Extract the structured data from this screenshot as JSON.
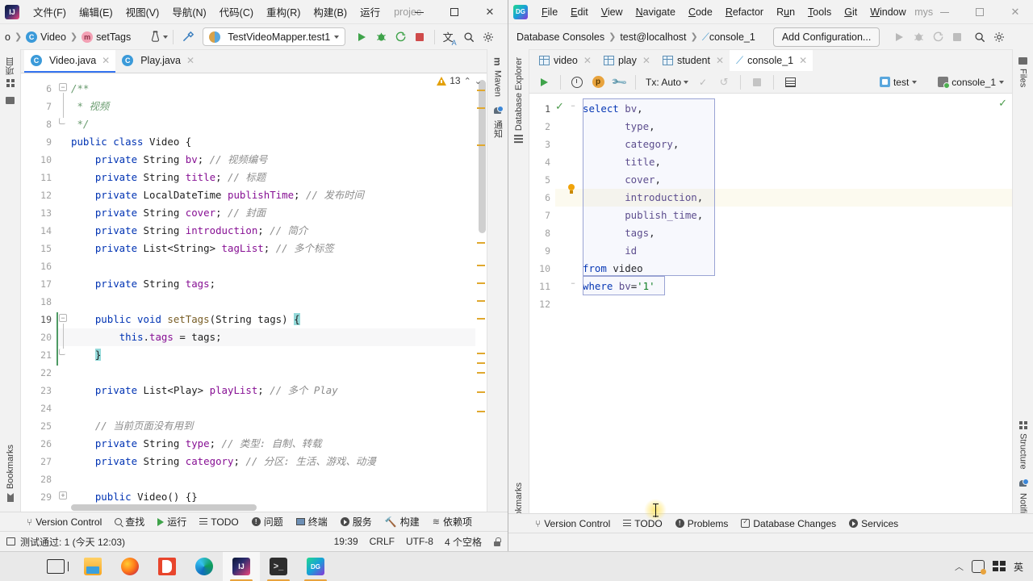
{
  "left_window": {
    "app_icon": "IJ",
    "menu": [
      {
        "label": "文件(F)",
        "key": "F"
      },
      {
        "label": "编辑(E)",
        "key": "E"
      },
      {
        "label": "视图(V)",
        "key": "V"
      },
      {
        "label": "导航(N)",
        "key": "N"
      },
      {
        "label": "代码(C)",
        "key": "C"
      },
      {
        "label": "重构(R)",
        "key": "R"
      },
      {
        "label": "构建(B)",
        "key": "B"
      },
      {
        "label": "运行",
        "key": ""
      }
    ],
    "project_name": "projec",
    "window_controls": {
      "minimize": "—",
      "maximize": "□",
      "close": "✕"
    },
    "breadcrumbs": [
      {
        "label": "o",
        "icon": ""
      },
      {
        "label": "Video",
        "icon": "class-icon"
      },
      {
        "label": "setTags",
        "icon": "method-icon"
      }
    ],
    "run_config": "TestVideoMapper.test1",
    "toolbar_icons": [
      "profiler-icon",
      "build-hammer-icon",
      "run-icon",
      "debug-icon",
      "run-coverage-icon",
      "stop-icon",
      "translate-icon",
      "search-icon",
      "settings-gear-icon"
    ],
    "editor_tabs": [
      {
        "label": "Video.java",
        "icon": "class-icon",
        "active": true
      },
      {
        "label": "Play.java",
        "icon": "class-icon",
        "active": false
      }
    ],
    "inspection_count": "13",
    "left_stripe": [
      "项目",
      "Bookmarks",
      "结构"
    ],
    "right_stripe": [
      "Maven",
      "通知"
    ],
    "bottom_tools": [
      {
        "label": "Version Control",
        "icon": "version-control-icon"
      },
      {
        "label": "查找",
        "icon": "search-icon"
      },
      {
        "label": "运行",
        "icon": "run-icon"
      },
      {
        "label": "TODO",
        "icon": "todo-icon"
      },
      {
        "label": "问题",
        "icon": "problems-icon"
      },
      {
        "label": "终端",
        "icon": "terminal-icon"
      },
      {
        "label": "服务",
        "icon": "services-icon"
      },
      {
        "label": "构建",
        "icon": "build-icon"
      },
      {
        "label": "依赖项",
        "icon": "dependencies-icon"
      }
    ],
    "status_left": "测试通过: 1 (今天 12:03)",
    "status_right": [
      "19:39",
      "CRLF",
      "UTF-8",
      "4 个空格"
    ],
    "code_lines": [
      {
        "num": 6,
        "html": "<span class='doc'>/**</span>",
        "indent": 0
      },
      {
        "num": 7,
        "html": "<span class='doc'> * 视频</span>",
        "indent": 0
      },
      {
        "num": 8,
        "html": "<span class='doc'> */</span>",
        "indent": 0
      },
      {
        "num": 9,
        "html": "<span class='kw'>public class</span> <span class='typ'>Video</span> <span class='pun'>{</span>",
        "indent": 0
      },
      {
        "num": 10,
        "html": "    <span class='kw'>private</span> <span class='typ'>String</span> <span class='fld'>bv</span><span class='pun'>;</span> <span class='cmt'>// 视频编号</span>",
        "indent": 0
      },
      {
        "num": 11,
        "html": "    <span class='kw'>private</span> <span class='typ'>String</span> <span class='fld'>title</span><span class='pun'>;</span> <span class='cmt'>// 标题</span>",
        "indent": 0
      },
      {
        "num": 12,
        "html": "    <span class='kw'>private</span> <span class='typ'>LocalDateTime</span> <span class='fld'>publishTime</span><span class='pun'>;</span> <span class='cmt'>// 发布时间</span>",
        "indent": 0
      },
      {
        "num": 13,
        "html": "    <span class='kw'>private</span> <span class='typ'>String</span> <span class='fld'>cover</span><span class='pun'>;</span> <span class='cmt'>// 封面</span>",
        "indent": 0
      },
      {
        "num": 14,
        "html": "    <span class='kw'>private</span> <span class='typ'>String</span> <span class='fld'>introduction</span><span class='pun'>;</span> <span class='cmt'>// 简介</span>",
        "indent": 0
      },
      {
        "num": 15,
        "html": "    <span class='kw'>private</span> <span class='typ'>List&lt;String&gt;</span> <span class='fld'>tagList</span><span class='pun'>;</span> <span class='cmt'>// 多个标签</span>",
        "indent": 0
      },
      {
        "num": 16,
        "html": "",
        "indent": 0
      },
      {
        "num": 17,
        "html": "    <span class='kw'>private</span> <span class='typ'>String</span> <span class='fld'>tags</span><span class='pun'>;</span>",
        "indent": 0
      },
      {
        "num": 18,
        "html": "",
        "indent": 0
      },
      {
        "num": 19,
        "html": "    <span class='kw'>public void</span> <span class='mth'>setTags</span><span class='pun'>(</span><span class='typ'>String</span> tags<span class='pun'>)</span> <span class='brmatch'>{</span>",
        "indent": 0
      },
      {
        "num": 20,
        "html": "        <span class='kw'>this</span><span class='pun'>.</span><span class='fld'>tags</span> <span class='pun'>=</span> tags<span class='pun'>;</span>",
        "indent": 0
      },
      {
        "num": 21,
        "html": "    <span class='brmatch'>}</span>",
        "indent": 0
      },
      {
        "num": 22,
        "html": "",
        "indent": 0
      },
      {
        "num": 23,
        "html": "    <span class='kw'>private</span> <span class='typ'>List&lt;Play&gt;</span> <span class='fld'>playList</span><span class='pun'>;</span> <span class='cmt'>// 多个 Play</span>",
        "indent": 0
      },
      {
        "num": 24,
        "html": "",
        "indent": 0
      },
      {
        "num": 25,
        "html": "    <span class='cmt'>// 当前页面没有用到</span>",
        "indent": 0
      },
      {
        "num": 26,
        "html": "    <span class='kw'>private</span> <span class='typ'>String</span> <span class='fld'>type</span><span class='pun'>;</span> <span class='cmt'>// 类型: 自制、转载</span>",
        "indent": 0
      },
      {
        "num": 27,
        "html": "    <span class='kw'>private</span> <span class='typ'>String</span> <span class='fld'>category</span><span class='pun'>;</span> <span class='cmt'>// 分区: 生活、游戏、动漫</span>",
        "indent": 0
      },
      {
        "num": 28,
        "html": "",
        "indent": 0
      },
      {
        "num": 29,
        "html": "    <span class='kw'>public</span> <span class='typ'>Video</span><span class='pun'>()</span> <span class='pun'>{}</span>",
        "indent": 0
      }
    ]
  },
  "right_window": {
    "app_icon": "DG",
    "menu": [
      {
        "label": "File"
      },
      {
        "label": "Edit"
      },
      {
        "label": "View"
      },
      {
        "label": "Navigate"
      },
      {
        "label": "Code"
      },
      {
        "label": "Refactor"
      },
      {
        "label": "Run"
      },
      {
        "label": "Tools"
      },
      {
        "label": "Git"
      },
      {
        "label": "Window"
      }
    ],
    "project_name": "mys",
    "window_controls": {
      "minimize": "—",
      "maximize": "□",
      "close": "✕"
    },
    "breadcrumbs": [
      "Database Consoles",
      "test@localhost",
      "console_1"
    ],
    "add_configuration": "Add Configuration...",
    "editor_tabs": [
      {
        "label": "video",
        "icon": "table-icon",
        "active": false
      },
      {
        "label": "play",
        "icon": "table-icon",
        "active": false
      },
      {
        "label": "student",
        "icon": "table-icon",
        "active": false
      },
      {
        "label": "console_1",
        "icon": "console-icon",
        "active": true
      }
    ],
    "console_toolbar": {
      "tx_mode": "Tx: Auto",
      "schema": "test",
      "session": "console_1",
      "icons": [
        "execute-icon",
        "history-icon",
        "parameters-icon",
        "settings-wrench-icon",
        "commit-icon",
        "rollback-icon",
        "stop-icon",
        "table-output-icon"
      ]
    },
    "left_stripe": [
      "Database Explorer",
      "Bookmarks"
    ],
    "right_stripe": [
      "Files",
      "Structure",
      "Notifications"
    ],
    "bottom_tools": [
      {
        "label": "Version Control",
        "icon": "version-control-icon"
      },
      {
        "label": "TODO",
        "icon": "todo-icon"
      },
      {
        "label": "Problems",
        "icon": "problems-icon"
      },
      {
        "label": "Database Changes",
        "icon": "database-changes-icon"
      },
      {
        "label": "Services",
        "icon": "services-icon"
      }
    ],
    "sql_lines": [
      {
        "num": 1,
        "html": "<span class='sql-kw'>select</span> <span class='sql-id'>bv</span><span class='pun'>,</span>"
      },
      {
        "num": 2,
        "html": "       <span class='sql-id'>type</span><span class='pun'>,</span>"
      },
      {
        "num": 3,
        "html": "       <span class='sql-id'>category</span><span class='pun'>,</span>"
      },
      {
        "num": 4,
        "html": "       <span class='sql-id'>title</span><span class='pun'>,</span>"
      },
      {
        "num": 5,
        "html": "       <span class='sql-id'>cover</span><span class='pun'>,</span>"
      },
      {
        "num": 6,
        "html": "       <span class='sql-id'>introduction</span><span class='pun'>,</span>"
      },
      {
        "num": 7,
        "html": "       <span class='sql-id'>publish_time</span><span class='pun'>,</span>"
      },
      {
        "num": 8,
        "html": "       <span class='sql-id'>tags</span><span class='pun'>,</span>"
      },
      {
        "num": 9,
        "html": "       <span class='sql-id'>id</span>"
      },
      {
        "num": 10,
        "html": "<span class='sql-kw'>from</span> <span class='sql-tbl'>video</span>"
      },
      {
        "num": 11,
        "html": "<span class='sql-kw'>where</span> <span class='sql-id'>bv</span><span class='pun'>=</span><span class='str'>'1'</span>"
      },
      {
        "num": 12,
        "html": ""
      }
    ]
  },
  "taskbar": {
    "items": [
      {
        "name": "start-button",
        "icon": "windows-logo-icon",
        "label": ""
      },
      {
        "name": "task-view-button",
        "icon": "task-view-icon",
        "label": ""
      },
      {
        "name": "file-explorer",
        "icon": "file-explorer-icon",
        "label": ""
      },
      {
        "name": "firefox",
        "icon": "firefox-icon",
        "label": ""
      },
      {
        "name": "office",
        "icon": "office-icon",
        "label": ""
      },
      {
        "name": "edge",
        "icon": "edge-icon",
        "label": ""
      },
      {
        "name": "intellij-idea",
        "icon": "intellij-icon",
        "label": "IJ"
      },
      {
        "name": "terminal",
        "icon": "terminal-icon",
        "label": "&gt;_"
      },
      {
        "name": "datagrip",
        "icon": "datagrip-icon",
        "label": "DG"
      }
    ],
    "tray": {
      "chevron": "︿",
      "ime_label": "英"
    }
  }
}
